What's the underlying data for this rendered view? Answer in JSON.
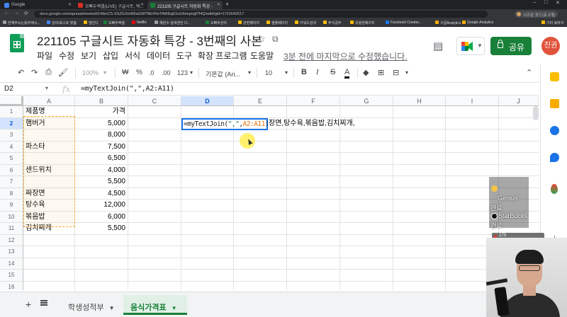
{
  "browser": {
    "tabs": [
      {
        "title": "Google",
        "favicon_color": "#4285f4",
        "active": false
      },
      {
        "title": "오빠두엑셀(LIVE) 구글시트, 엑...",
        "favicon_color": "#d93025",
        "active": false
      },
      {
        "title": "221105 구글시트 자동화 특강 -",
        "favicon_color": "#188038",
        "active": true
      }
    ],
    "new_tab": "+",
    "window_controls": [
      "–",
      "□",
      "✕"
    ],
    "nav_buttons": [
      "←",
      "→",
      "⟳"
    ],
    "url": "docs.google.com/spreadsheets/d/14lknCS-XSZG2mW6aGW7NbVReTAWEqESoU6mqmgf7f4Q/edit#gid=1731642517",
    "profile": "시즈문 포드(유 2개)"
  },
  "bookmarks": [
    {
      "label": "전체주소는동부에시...",
      "color": "#9aa0a6"
    },
    {
      "label": "강의/포스트 맞춤",
      "color": "#4285f4"
    },
    {
      "label": "엠인다",
      "color": "#fbbc04"
    },
    {
      "label": "오빠두엑셀",
      "color": "#188038"
    },
    {
      "label": "Netflix",
      "color": "#e50914"
    },
    {
      "label": "혜원수 검색엔진 다...",
      "color": "#9aa0a6"
    },
    {
      "label": "오빠두관리",
      "color": "#188038"
    },
    {
      "label": "관련페이지",
      "color": "#fbbc04"
    },
    {
      "label": "샘플페이지",
      "color": "#fbbc04"
    },
    {
      "label": "키워드검색",
      "color": "#fbbc04"
    },
    {
      "label": "주식공부",
      "color": "#fbbc04"
    },
    {
      "label": "유용한페이지",
      "color": "#fbbc04"
    },
    {
      "label": "Facebook Creator...",
      "color": "#1877f2"
    },
    {
      "label": "구글Analytics",
      "color": "#f9ab00"
    },
    {
      "label": "Google Analytics",
      "color": "#f9ab00"
    },
    {
      "label": "기타 북마크",
      "color": "#fbbc04"
    }
  ],
  "doc": {
    "title": "221105 구글시트 자동화 특강 - 3번째의 사본",
    "menus": [
      "파일",
      "수정",
      "보기",
      "삽입",
      "서식",
      "데이터",
      "도구",
      "확장 프로그램",
      "도움말"
    ],
    "last_edit": "3분 전에 마지막으로 수정했습니다.",
    "share_label": "공유",
    "avatar_text": "진권"
  },
  "toolbar": {
    "zoom": "100%",
    "currency": "₩",
    "percent": "%",
    "dec_minus": ".0",
    "dec_plus": ".00",
    "number_format": "123",
    "font": "기본값 (Ari...",
    "font_size": "10",
    "bold": "B",
    "italic": "I",
    "strike": "S",
    "text_color": "A"
  },
  "formula_bar": {
    "name_box": "D2",
    "fx": "fx",
    "formula": "=myTextJoin(\",\",A2:A11)"
  },
  "grid": {
    "columns": [
      "A",
      "B",
      "C",
      "D",
      "E",
      "F",
      "G",
      "H",
      "I",
      "J"
    ],
    "selected_column": "D",
    "rows": [
      "1",
      "2",
      "3",
      "4",
      "5",
      "6",
      "7",
      "8",
      "9",
      "10",
      "11",
      "12",
      "13",
      "14",
      "15",
      "16"
    ],
    "selected_row": "2",
    "cells": [
      [
        "제품명",
        "가격"
      ],
      [
        "햄버거",
        "5,000"
      ],
      [
        "",
        "8,000"
      ],
      [
        "파스타",
        "7,500"
      ],
      [
        "",
        "6,500"
      ],
      [
        "샌드위치",
        "4,000"
      ],
      [
        "",
        "5,500"
      ],
      [
        "짜장면",
        "4,500"
      ],
      [
        "탕수육",
        "12,000"
      ],
      [
        "볶음밥",
        "6,000"
      ],
      [
        "김치찌개",
        "5,500"
      ]
    ],
    "edit": {
      "prefix": "=myTextJoin(",
      "quote": "\",\"",
      "comma": ",",
      "range": "A2:A11",
      "suffix": ")"
    },
    "overflow_text": "장면,탕수육,볶음밥,김치찌개,"
  },
  "sheet_tabs": [
    {
      "label": "학생성적부",
      "active": false
    },
    {
      "label": "음식가격표",
      "active": true
    }
  ],
  "overlay": {
    "chat": [
      {
        "name": "Genius",
        "msg": "관료"
      },
      {
        "name": "StarBucks",
        "msg": "관료"
      }
    ],
    "viewer_count": "173"
  }
}
